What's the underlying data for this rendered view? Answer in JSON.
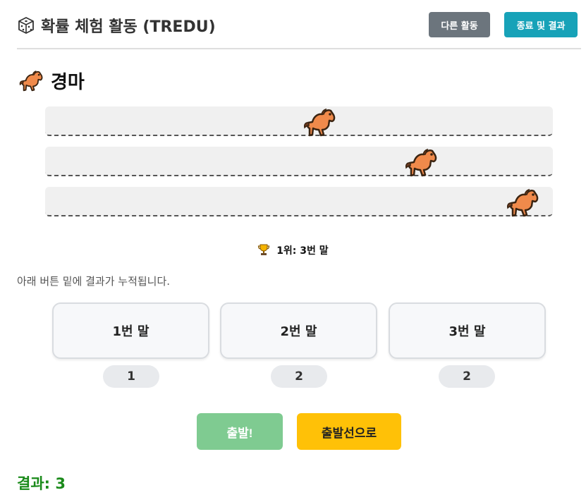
{
  "header": {
    "title": "확률 체험 활동 (TREDU)",
    "dice_icon": "dice-icon",
    "buttons": {
      "other": "다른 활동",
      "end": "종료 및 결과"
    },
    "colors": {
      "other": "#6c757d",
      "end": "#17a2b8"
    }
  },
  "race": {
    "title": "경마",
    "title_icon": "horse-icon",
    "lanes": [
      {
        "horse_icon": "horse-icon",
        "progress": 0.52
      },
      {
        "horse_icon": "horse-icon",
        "progress": 0.72
      },
      {
        "horse_icon": "horse-icon",
        "progress": 0.92
      }
    ],
    "winner_icon": "trophy-icon",
    "winner_text": "1위: 3번 말"
  },
  "note": "아래 버튼 밑에 결과가 누적됩니다.",
  "choices": [
    {
      "label": "1번 말",
      "count": "1"
    },
    {
      "label": "2번 말",
      "count": "2"
    },
    {
      "label": "3번 말",
      "count": "2"
    }
  ],
  "actions": {
    "start": "출발!",
    "reset": "출발선으로",
    "colors": {
      "start": "#7fcb91",
      "reset": "#ffc107"
    }
  },
  "result": "결과: 3"
}
